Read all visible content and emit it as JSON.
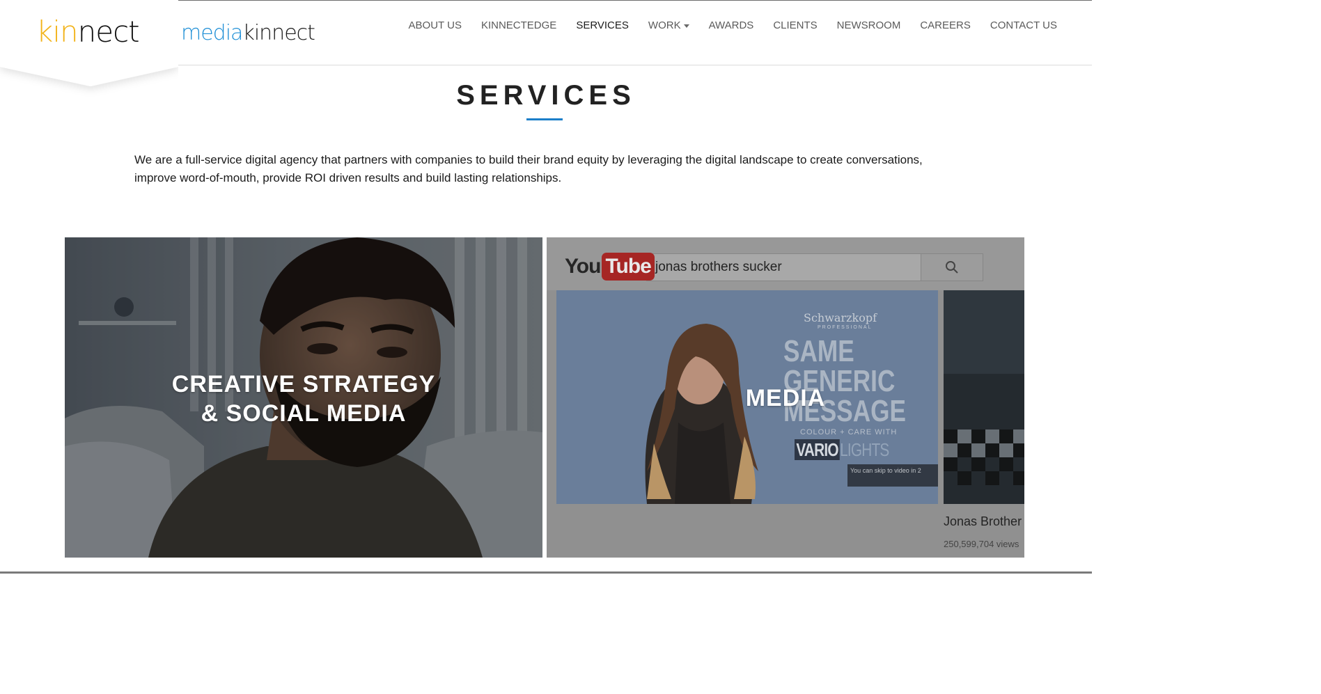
{
  "header": {
    "logo_primary": {
      "part1": "kin",
      "part2": "nect"
    },
    "logo_secondary": {
      "part1": "media",
      "part2": "kinnect"
    },
    "nav": [
      {
        "label": "ABOUT US"
      },
      {
        "label": "KINNECTEDGE"
      },
      {
        "label": "SERVICES",
        "active": true
      },
      {
        "label": "WORK",
        "dropdown": true
      },
      {
        "label": "AWARDS"
      },
      {
        "label": "CLIENTS"
      },
      {
        "label": "NEWSROOM"
      },
      {
        "label": "CAREERS"
      },
      {
        "label": "CONTACT US"
      }
    ]
  },
  "main": {
    "title": "SERVICES",
    "intro": "We are a full-service digital agency that partners with companies to build their brand equity by leveraging the digital landscape to create conversations, improve word-of-mouth, provide ROI driven results and build lasting relationships.",
    "cards": [
      {
        "label_line1": "CREATIVE STRATEGY",
        "label_line2": "& SOCIAL MEDIA"
      },
      {
        "label": "MEDIA",
        "youtube": {
          "logo_you": "You",
          "logo_tube": "Tube",
          "search_value": "jonas brothers sucker",
          "ad": {
            "brand": "Schwarzkopf",
            "brand_sub": "PROFESSIONAL",
            "headline_1": "SAME",
            "headline_2": "GENERIC",
            "headline_3": "MESSAGE",
            "colour_line": "COLOUR + CARE WITH",
            "vario": "VARIO",
            "lights": "LIGHTS",
            "skip_text": "You can skip to video in 2"
          },
          "side_title": "Jonas Brother",
          "side_views": "250,599,704 views"
        }
      }
    ]
  },
  "colors": {
    "accent_blue": "#1c7fc9",
    "logo_yellow": "#f2b319",
    "media_blue": "#1f8fd6",
    "youtube_red": "#b3211f"
  }
}
